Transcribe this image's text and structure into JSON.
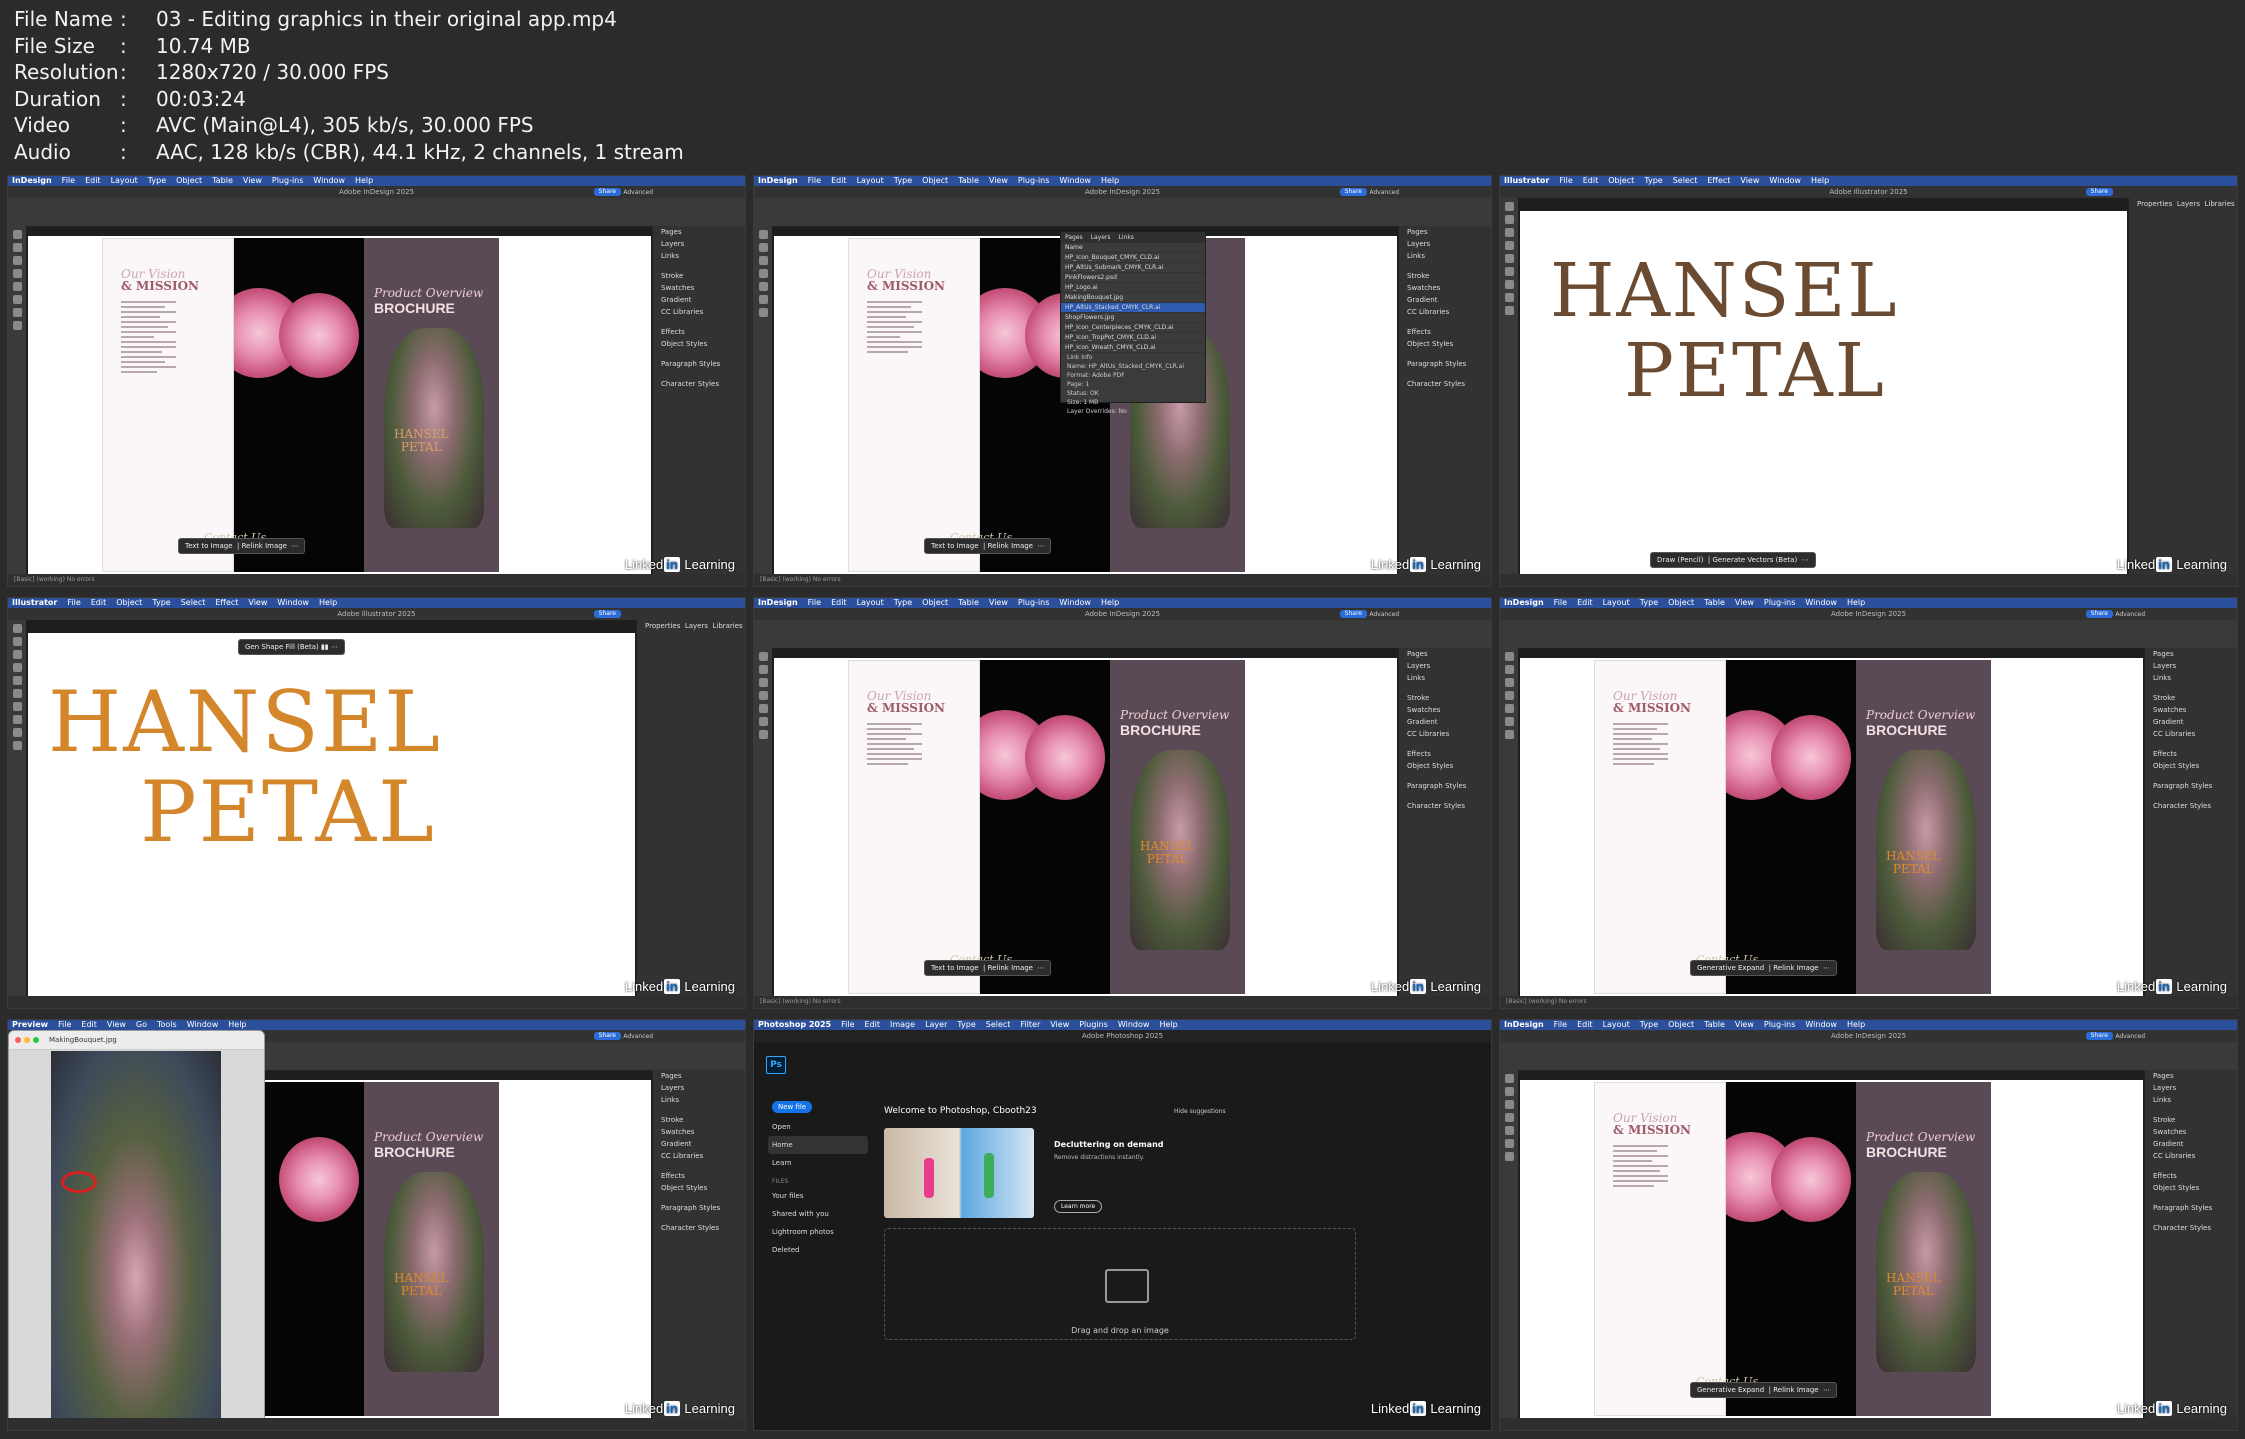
{
  "meta": [
    {
      "key": "File Name",
      "value": "03 - Editing graphics in their original app.mp4"
    },
    {
      "key": "File Size",
      "value": "10.74 MB"
    },
    {
      "key": "Resolution",
      "value": "1280x720 / 30.000 FPS"
    },
    {
      "key": "Duration",
      "value": "00:03:24"
    },
    {
      "key": "Video",
      "value": "AVC (Main@L4), 305 kb/s, 30.000 FPS"
    },
    {
      "key": "Audio",
      "value": "AAC, 128 kb/s (CBR), 44.1 kHz, 2 channels, 1 stream"
    }
  ],
  "watermark": {
    "brand": "Linked",
    "in": "in",
    "learning": "Learning"
  },
  "indesign": {
    "app": "InDesign",
    "menus": [
      "File",
      "Edit",
      "Layout",
      "Type",
      "Object",
      "Table",
      "View",
      "Plug-ins",
      "Window",
      "Help"
    ],
    "title": "Adobe InDesign 2025",
    "share": "Share",
    "advanced": "Advanced",
    "panels": [
      "Pages",
      "Layers",
      "Links",
      "Stroke",
      "Swatches",
      "Gradient",
      "CC Libraries",
      "Effects",
      "Object Styles",
      "Paragraph Styles",
      "Character Styles"
    ],
    "status": "[Basic] (working)    No errors"
  },
  "illustrator": {
    "app": "Illustrator",
    "menus": [
      "File",
      "Edit",
      "Object",
      "Type",
      "Select",
      "Effect",
      "View",
      "Window",
      "Help"
    ],
    "title": "Adobe Illustrator 2025",
    "share": "Share",
    "panels": [
      "Properties",
      "Layers",
      "Libraries"
    ]
  },
  "brochure": {
    "our_vision": "Our Vision",
    "mission": "& MISSION",
    "product_overview": "Product Overview",
    "brochure": "BROCHURE",
    "contact": "Contact Us",
    "hansel": "HANSEL",
    "petal": "PETAL"
  },
  "logo": {
    "line1": "HANSEL",
    "line2": "PETAL"
  },
  "context": {
    "text_to_image": "Text to Image",
    "relink": "Relink Image",
    "gen_expand": "Generative Expand",
    "draw_pencil": "Draw (Pencil)",
    "gen_vectors": "Generate Vectors (Beta)",
    "gen_shape_fill": "Gen Shape Fill (Beta)"
  },
  "links_panel": {
    "tabs": [
      "Pages",
      "Layers",
      "Links"
    ],
    "name_header": "Name",
    "rows": [
      "HP_Icon_Bouquet_CMYK_CLD.ai",
      "HP_AltUs_Submark_CMYK_CLR.ai",
      "PinkFlowers2.psd",
      "HP_Logo.ai",
      "MakingBouquet.jpg",
      "HP_AltUs_Stacked_CMYK_CLR.ai",
      "ShopFlowers.jpg",
      "HP_Icon_Centerpieces_CMYK_CLD.ai",
      "HP_Icon_TropPot_CMYK_CLD.ai",
      "HP_Icon_Wreath_CMYK_CLD.ai"
    ],
    "selected_index": 5,
    "info": [
      "Link Info",
      "Name: HP_AltUs_Stacked_CMYK_CLR.ai",
      "Format: Adobe PDF",
      "Page: 1",
      "Status: OK",
      "Size: 1 MB",
      "Layer Overrides: No"
    ]
  },
  "photoshop": {
    "app": "Photoshop 2025",
    "menus": [
      "File",
      "Edit",
      "Image",
      "Layer",
      "Type",
      "Select",
      "Filter",
      "View",
      "Plugins",
      "Window",
      "Help"
    ],
    "title": "Adobe Photoshop 2025",
    "new_file": "New file",
    "open": "Open",
    "home": "Home",
    "learn": "Learn",
    "files": "FILES",
    "your_files": "Your files",
    "shared": "Shared with you",
    "lightroom": "Lightroom photos",
    "deleted": "Deleted",
    "welcome": "Welcome to Photoshop, Cbooth23",
    "hide": "Hide suggestions",
    "declutter": "Decluttering on demand",
    "declutter_sub": "Remove distractions instantly.",
    "learn_more": "Learn more",
    "drop": "Drag and drop an image"
  },
  "preview": {
    "app": "Preview",
    "menus": [
      "File",
      "Edit",
      "View",
      "Go",
      "Tools",
      "Window",
      "Help"
    ],
    "filename": "MakingBouquet.jpg"
  }
}
